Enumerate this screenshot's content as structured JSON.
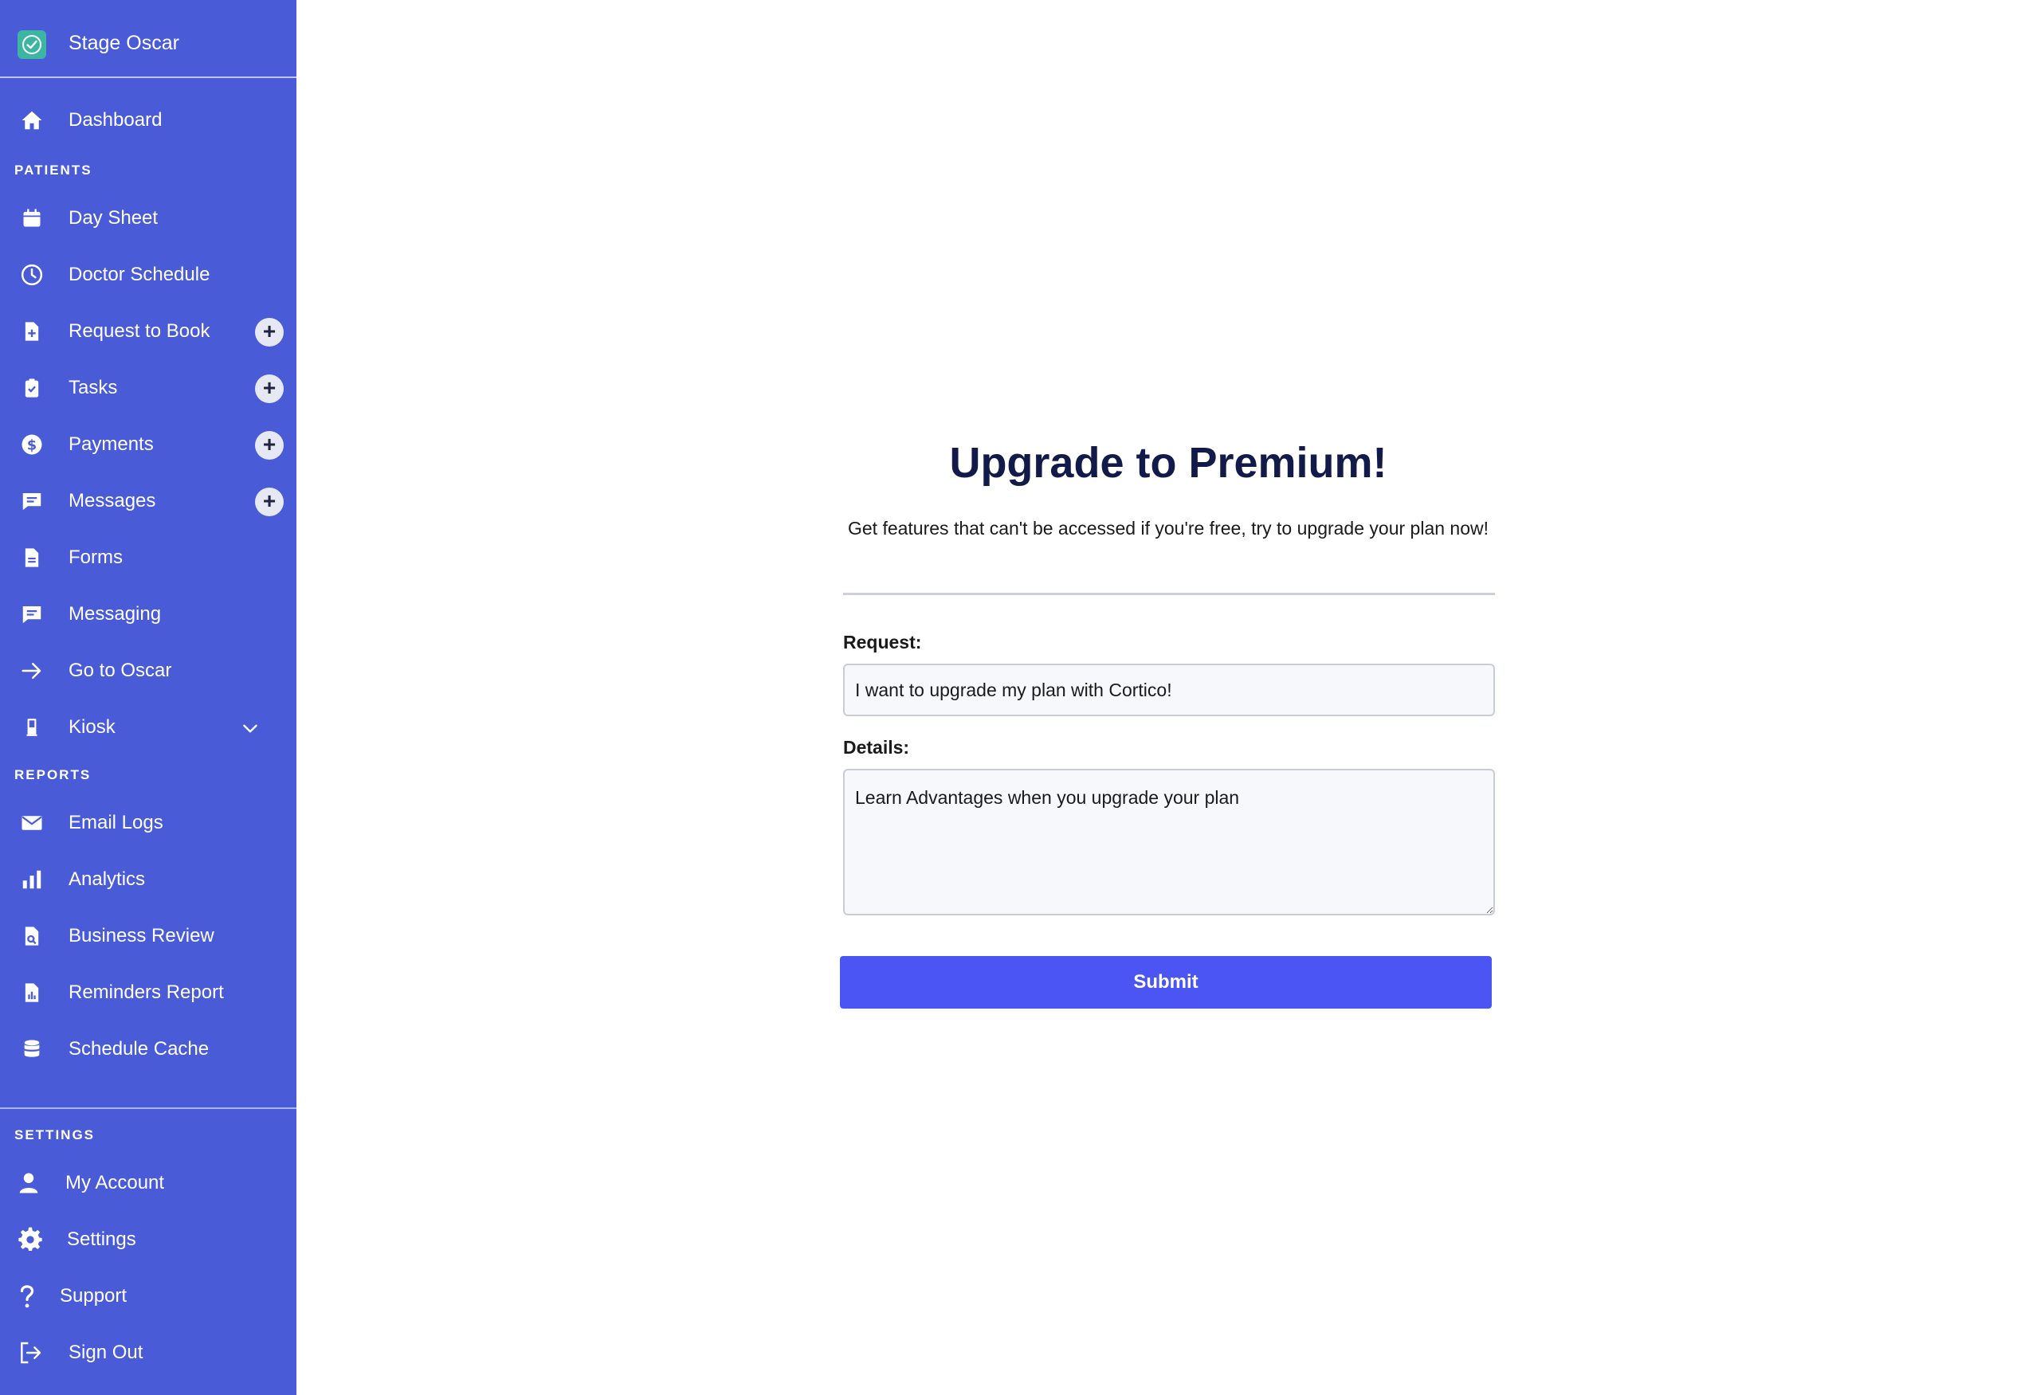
{
  "brand": {
    "name": "Stage Oscar"
  },
  "nav": {
    "dashboard": "Dashboard",
    "patients_heading": "PATIENTS",
    "day_sheet": "Day Sheet",
    "doctor_schedule": "Doctor Schedule",
    "request_to_book": "Request to Book",
    "tasks": "Tasks",
    "payments": "Payments",
    "messages": "Messages",
    "forms": "Forms",
    "messaging": "Messaging",
    "go_to_oscar": "Go to Oscar",
    "kiosk": "Kiosk",
    "reports_heading": "REPORTS",
    "email_logs": "Email Logs",
    "analytics": "Analytics",
    "business_review": "Business Review",
    "reminders_report": "Reminders Report",
    "schedule_cache": "Schedule Cache",
    "settings_heading": "SETTINGS",
    "my_account": "My Account",
    "settings": "Settings",
    "support": "Support",
    "sign_out": "Sign Out",
    "plus_symbol": "+"
  },
  "upgrade": {
    "title": "Upgrade to Premium!",
    "subtitle": "Get features that can't be accessed if you're free, try to upgrade your plan now!",
    "request_label": "Request:",
    "request_value": "I want to upgrade my plan with Cortico!",
    "details_label": "Details:",
    "details_value": "Learn Advantages when you upgrade your plan",
    "submit_label": "Submit"
  },
  "colors": {
    "sidebar_bg": "#4a5bd8",
    "accent_button": "#4a55f3",
    "title_text": "#121a4a",
    "logo_teal": "#3cb6a3"
  },
  "icons": {
    "brand": "check-logo-icon",
    "dashboard": "home-icon",
    "day_sheet": "calendar-icon",
    "doctor_schedule": "clock-icon",
    "request_to_book": "document-plus-icon",
    "tasks": "clipboard-check-icon",
    "payments": "dollar-icon",
    "messages": "chat-icon",
    "forms": "document-icon",
    "messaging": "chat-icon",
    "go_to_oscar": "arrow-right-icon",
    "kiosk": "kiosk-icon",
    "email_logs": "mail-icon",
    "analytics": "bar-chart-icon",
    "business_review": "document-search-icon",
    "reminders_report": "report-icon",
    "schedule_cache": "database-icon",
    "my_account": "user-icon",
    "settings": "gear-icon",
    "support": "question-icon",
    "sign_out": "sign-out-icon"
  }
}
